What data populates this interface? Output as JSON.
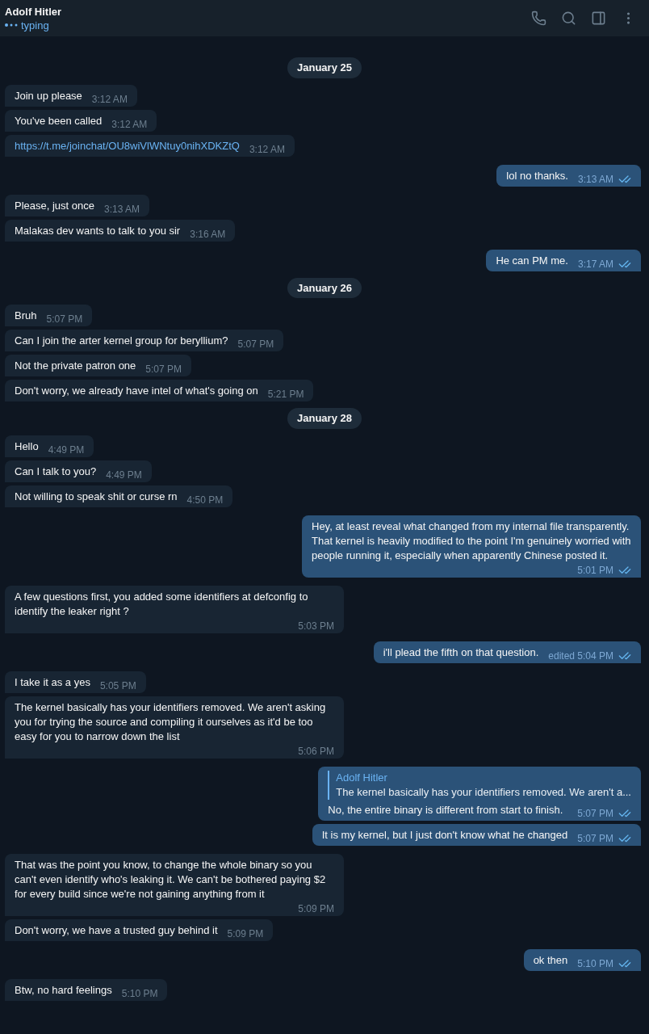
{
  "header": {
    "title": "Adolf Hitler",
    "status": "typing"
  },
  "items": [
    {
      "kind": "date",
      "text": "January 25"
    },
    {
      "kind": "message",
      "outgoing": false,
      "text": "Join up please",
      "time": "3:12 AM"
    },
    {
      "kind": "message",
      "outgoing": false,
      "text": "You've been called",
      "time": "3:12 AM"
    },
    {
      "kind": "link",
      "outgoing": false,
      "text": "https://t.me/joinchat/OU8wiVlWNtuy0nihXDKZtQ",
      "time": "3:12 AM"
    },
    {
      "kind": "message",
      "outgoing": true,
      "read": true,
      "text": "lol no thanks.",
      "time": "3:13 AM"
    },
    {
      "kind": "message",
      "outgoing": false,
      "text": "Please, just once",
      "time": "3:13 AM"
    },
    {
      "kind": "message",
      "outgoing": false,
      "text": "Malakas dev wants to talk to you sir",
      "time": "3:16 AM"
    },
    {
      "kind": "message",
      "outgoing": true,
      "read": true,
      "text": "He can PM me.",
      "time": "3:17 AM"
    },
    {
      "kind": "date",
      "text": "January 26"
    },
    {
      "kind": "message",
      "outgoing": false,
      "text": "Bruh",
      "time": "5:07 PM"
    },
    {
      "kind": "message",
      "outgoing": false,
      "text": "Can I join the arter kernel group for beryllium?",
      "time": "5:07 PM"
    },
    {
      "kind": "message",
      "outgoing": false,
      "text": "Not the private patron one",
      "time": "5:07 PM"
    },
    {
      "kind": "message",
      "outgoing": false,
      "text": "Don't worry, we already have intel of what's going on",
      "time": "5:21 PM"
    },
    {
      "kind": "date",
      "text": "January 28"
    },
    {
      "kind": "message",
      "outgoing": false,
      "text": "Hello",
      "time": "4:49 PM"
    },
    {
      "kind": "message",
      "outgoing": false,
      "text": "Can I talk to you?",
      "time": "4:49 PM"
    },
    {
      "kind": "message",
      "outgoing": false,
      "text": "Not willing to speak shit or curse rn",
      "time": "4:50 PM"
    },
    {
      "kind": "message",
      "outgoing": true,
      "read": true,
      "text": "Hey, at least reveal what changed from my internal file transparently. That kernel is heavily modified to the point I'm genuinely worried with people running it, especially when apparently Chinese posted it.",
      "time": "5:01 PM"
    },
    {
      "kind": "message",
      "outgoing": false,
      "text": "A few questions first, you added some identifiers at defconfig to identify the leaker right ?",
      "time": "5:03 PM"
    },
    {
      "kind": "message",
      "outgoing": true,
      "read": true,
      "text": "i'll plead the fifth on that question.",
      "time": "edited 5:04 PM"
    },
    {
      "kind": "message",
      "outgoing": false,
      "text": "I take it as a yes",
      "time": "5:05 PM"
    },
    {
      "kind": "message",
      "outgoing": false,
      "text": "The kernel basically has your identifiers removed. We aren't asking you for trying the source and compiling it ourselves as it'd be too easy for you to narrow down the list",
      "time": "5:06 PM"
    },
    {
      "kind": "message",
      "outgoing": true,
      "read": true,
      "reply": {
        "name": "Adolf Hitler",
        "text": "The kernel basically has your identifiers removed. We aren't a..."
      },
      "text": "No, the entire binary is different from start to finish.",
      "time": "5:07 PM"
    },
    {
      "kind": "message",
      "outgoing": true,
      "read": true,
      "text": "It is my kernel, but I just don't know what he changed",
      "time": "5:07 PM"
    },
    {
      "kind": "message",
      "outgoing": false,
      "text": "That was the point you know, to change the whole binary so you can't even identify who's leaking it. We can't be bothered paying $2 for every build since we're not gaining anything from it",
      "time": "5:09 PM"
    },
    {
      "kind": "message",
      "outgoing": false,
      "text": "Don't worry, we have a trusted guy behind it",
      "time": "5:09 PM"
    },
    {
      "kind": "message",
      "outgoing": true,
      "read": true,
      "text": "ok then",
      "time": "5:10 PM"
    },
    {
      "kind": "message",
      "outgoing": false,
      "text": "Btw, no hard feelings",
      "time": "5:10 PM"
    }
  ]
}
